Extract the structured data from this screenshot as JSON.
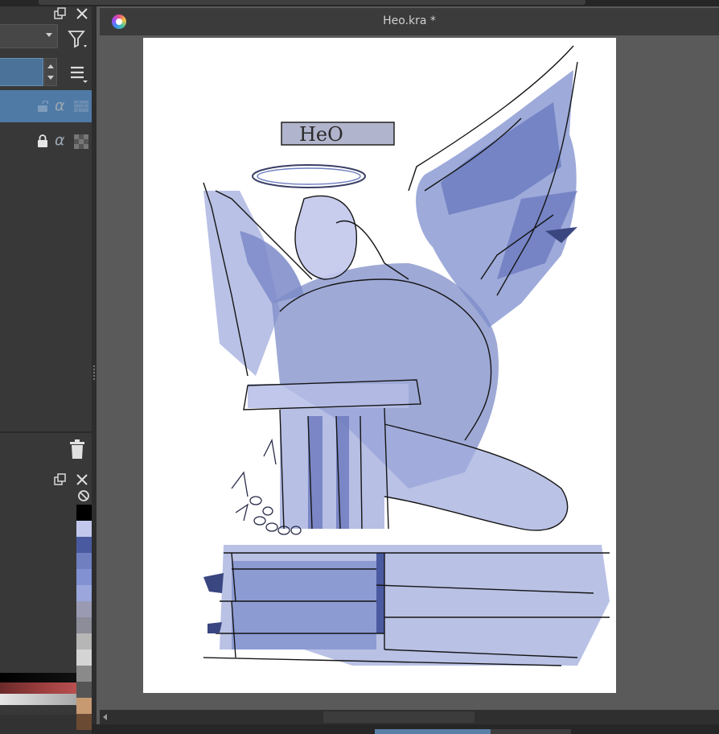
{
  "document": {
    "title": "Heo.kra *",
    "sketch_text": "HeO"
  },
  "layers_docker": {
    "float_icon": "float-window-icon",
    "close_icon": "close-icon",
    "filter_icon": "filter-icon",
    "menu_icon": "menu-icon",
    "layers": [
      {
        "locked": false,
        "selected": true,
        "alpha_label": "α"
      },
      {
        "locked": true,
        "selected": false,
        "alpha_label": "α"
      }
    ],
    "delete_icon": "trash-icon"
  },
  "palette_docker": {
    "no_color_icon": "no-color-icon",
    "swatches": [
      "#000000",
      "#c2c8ec",
      "#4a5aa0",
      "#6f7fc0",
      "#8291d2",
      "#9aa6dc",
      "#9a9bb3",
      "#8d8d9a",
      "#b6b6b6",
      "#d4d4d4",
      "#8a8a8a",
      "#555555",
      "#c79a72",
      "#6b4a34"
    ]
  },
  "colors": {
    "accent": "#4f7aa6",
    "sketch": "#7a89c8"
  }
}
